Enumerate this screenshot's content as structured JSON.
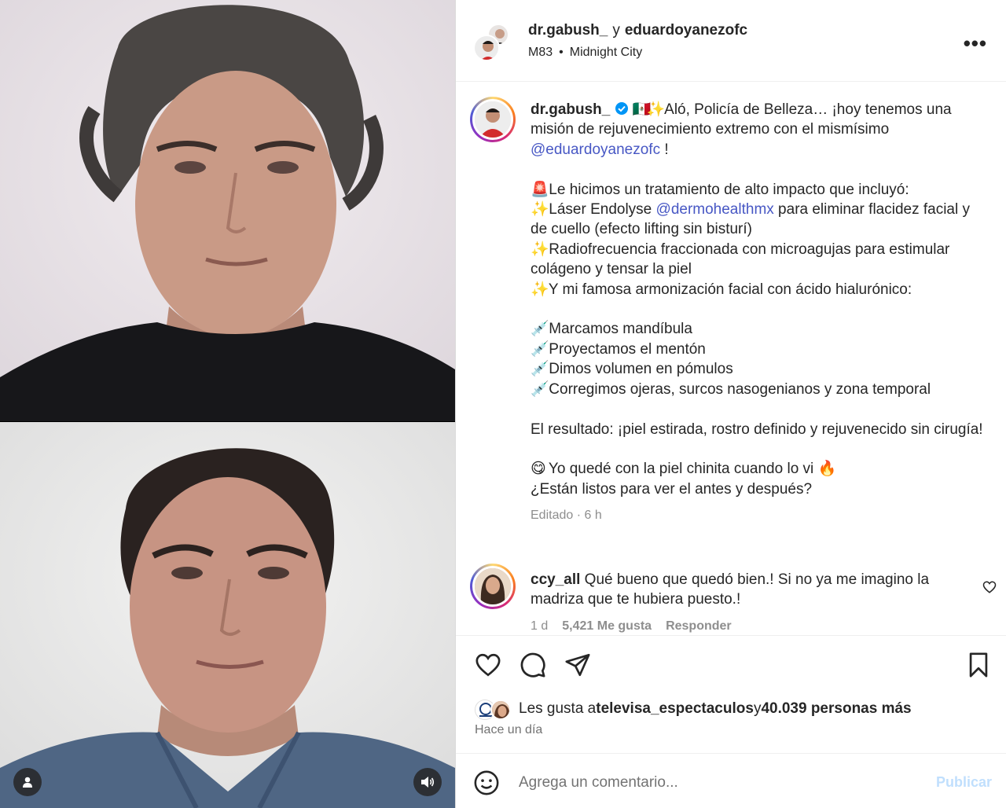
{
  "post": {
    "authors": {
      "primary": "dr.gabush_",
      "connector": "y",
      "collaborator": "eduardoyanezofc"
    },
    "audio": {
      "artist": "M83",
      "separator": "•",
      "track": "Midnight City"
    },
    "more_icon": "more-horizontal-icon"
  },
  "caption": {
    "username": "dr.gabush_",
    "line1_text": " Aló, Policía de Belleza… ¡hoy tenemos una misión de rejuvenecimiento extremo con el mismísimo ",
    "mention1": "@eduardoyanezofc",
    "line1_end": " !",
    "treatment_intro": " Le hicimos un tratamiento de alto impacto que incluyó:",
    "laser_pre": " Láser Endolyse ",
    "mention2": "@dermohealthmx",
    "laser_post": " para eliminar flacidez facial y de cuello (efecto lifting sin bisturí)",
    "radio": " Radiofrecuencia fraccionada con microagujas para estimular colágeno y tensar la piel",
    "armon": " Y mi famosa armonización facial con ácido hialurónico:",
    "bullets": [
      " Marcamos mandíbula",
      " Proyectamos el mentón",
      " Dimos volumen en pómulos",
      " Corregimos ojeras, surcos nasogenianos y zona temporal"
    ],
    "result": "El resultado: ¡piel estirada, rostro definido y rejuvenecido sin cirugía!",
    "reaction_pre": " Yo quedé con la piel chinita cuando lo vi ",
    "question": "¿Están listos para ver el antes y después?",
    "meta": "Editado · 6 h",
    "emojis": {
      "sparkle": "✨",
      "siren": "🚨",
      "syringe": "💉",
      "fire": "🔥",
      "smile": "😋",
      "flag": "🇲🇽"
    }
  },
  "comment": {
    "username": "ccy_all",
    "text": " Qué bueno que quedó bien.! Si no ya me imagino la madriza que te hubiera puesto.!",
    "age": "1 d",
    "likes": "5,421 Me gusta",
    "reply": "Responder"
  },
  "likes": {
    "prefix": "Les gusta a ",
    "user": "televisa_espectaculos",
    "middle": " y ",
    "others": "40.039 personas más",
    "time": "Hace un día"
  },
  "add_comment": {
    "placeholder": "Agrega un comentario...",
    "publish": "Publicar"
  },
  "colors": {
    "mention": "#4757c4",
    "publish_disabled": "#c0dffd",
    "meta": "#8e8e8e"
  }
}
